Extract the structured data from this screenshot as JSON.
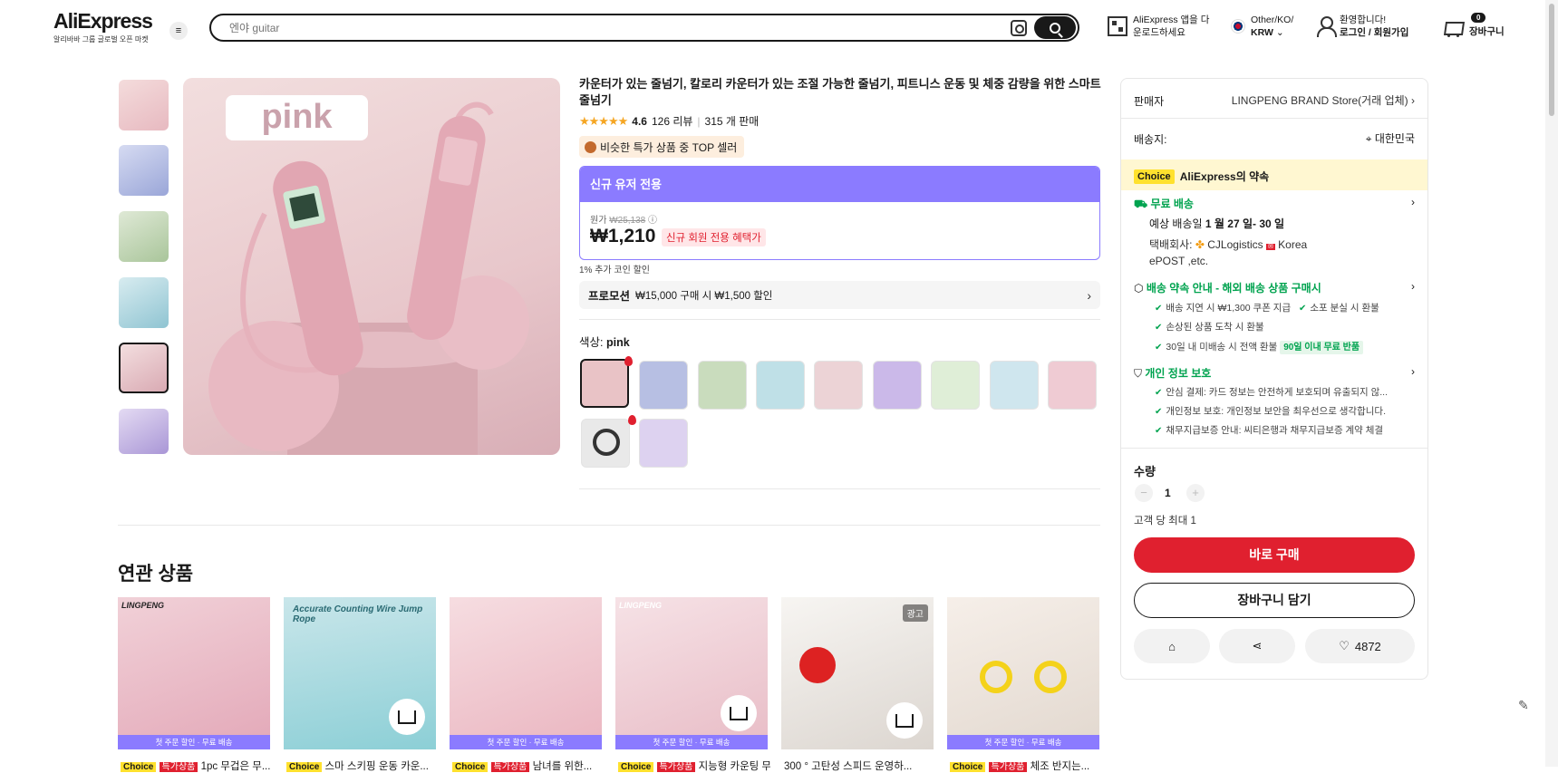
{
  "header": {
    "logo": "AliExpress",
    "logo_tagline": "알리바바 그룹 글로벌 오픈 마켓",
    "search_placeholder": "엔야 guitar",
    "app_promo_line1": "AliExpress 앱을 다",
    "app_promo_line2": "운로드하세요",
    "region_line1": "Other/KO/",
    "region_line2": "KRW",
    "user_greeting": "환영합니다!",
    "user_login": "로그인 / 회원가입",
    "cart_count": "0",
    "cart_label": "장바구니"
  },
  "product": {
    "title": "카운터가 있는 줄넘기, 칼로리 카운터가 있는 조절 가능한 줄넘기, 피트니스 운동 및 체중 감량을 위한 스마트 줄넘기",
    "rating": "4.6",
    "reviews": "126 리뷰",
    "sold": "315 개 판매",
    "top_badge": "비슷한 특가 상품 중 TOP 셀러",
    "new_user_band": "신규 유저 전용",
    "original_label": "원가",
    "original_price": "₩25,138",
    "price": "₩1,210",
    "new_user_benefit": "신규 회원 전용 혜택가",
    "coin_note": "1% 추가 코인 할인",
    "promo_label": "프로모션",
    "promo_text": "₩15,000 구매 시 ₩1,500 할인",
    "color_label": "색상:",
    "color_value": "pink",
    "main_image_text": "pink",
    "swatch_colors": [
      "#e9c3c6",
      "#b7bfe3",
      "#c9dcbd",
      "#bfe0e7",
      "#ecd3d6",
      "#cbb9e9",
      "#dfeed7",
      "#cfe6ee",
      "#efcbd3",
      "#3a3a3a",
      "#ddd2f0"
    ]
  },
  "panel": {
    "seller_label": "판매자",
    "seller_name": "LINGPENG BRAND Store(거래 업체)",
    "ship_to_label": "배송지:",
    "ship_to_value": "대한민국",
    "choice_tag": "Choice",
    "choice_promise": "AliExpress의 약속",
    "free_shipping": "무료 배송",
    "delivery_prefix": "예상 배송일",
    "delivery_date": "1 월 27 일- 30 일",
    "carrier_prefix": "택배회사:",
    "carrier_1": "CJLogistics",
    "carrier_2": "Korea",
    "carrier_3": "ePOST ,etc.",
    "promise_title": "배송 약속 안내 - 해외 배송 상품 구매시",
    "promise_1": "배송 지연 시 ₩1,300 쿠폰 지급",
    "promise_2": "소포 분실 시 환불",
    "promise_3": "손상된 상품 도착 시 환불",
    "promise_4": "30일 내 미배송 시 전액 환불",
    "promise_badge": "90일 이내 무료 반품",
    "privacy_title": "개인 정보 보호",
    "privacy_1": "안심 결제: 카드 정보는 안전하게 보호되며 유출되지 않...",
    "privacy_2": "개인정보 보호: 개인정보 보안을 최우선으로 생각합니다.",
    "privacy_3": "채무지급보증 안내: 씨티은행과 채무지급보증 계약 체결",
    "qty_label": "수량",
    "qty_value": "1",
    "qty_limit": "고객 당 최대 1",
    "buy_now": "바로 구매",
    "add_to_cart": "장바구니 담기",
    "wishlist_count": "4872"
  },
  "related": {
    "title": "연관 상품",
    "strip_text": "첫 주문 할인 · 무료 배송",
    "ad_label": "광고",
    "cards": [
      {
        "tag1": "Choice",
        "tag2": "특가상품",
        "title": "1pc 무겁은 무...",
        "img": "LINGPENG",
        "color": "#ebb8c4"
      },
      {
        "tag1": "Choice",
        "tag2": "",
        "title": "스마 스키핑 운동 카운...",
        "img": "Accurate Counting Wire Jump Rope",
        "color": "#9fd3d8"
      },
      {
        "tag1": "Choice",
        "tag2": "특가상품",
        "title": "남녀를 위한...",
        "img": "",
        "color": "#f2c9cf"
      },
      {
        "tag1": "Choice",
        "tag2": "특가상품",
        "title": "지능형 카운팅 무선 줄...",
        "img": "LINGPENG",
        "color": "#efd0d6"
      },
      {
        "tag1": "",
        "tag2": "",
        "title": "300 ° 고탄성 스피드 운영하...",
        "img": "",
        "color": "#f4f1ee"
      },
      {
        "tag1": "Choice",
        "tag2": "특가상품",
        "title": "체조 반지는...",
        "img": "",
        "color": "#efe7e2"
      }
    ]
  }
}
